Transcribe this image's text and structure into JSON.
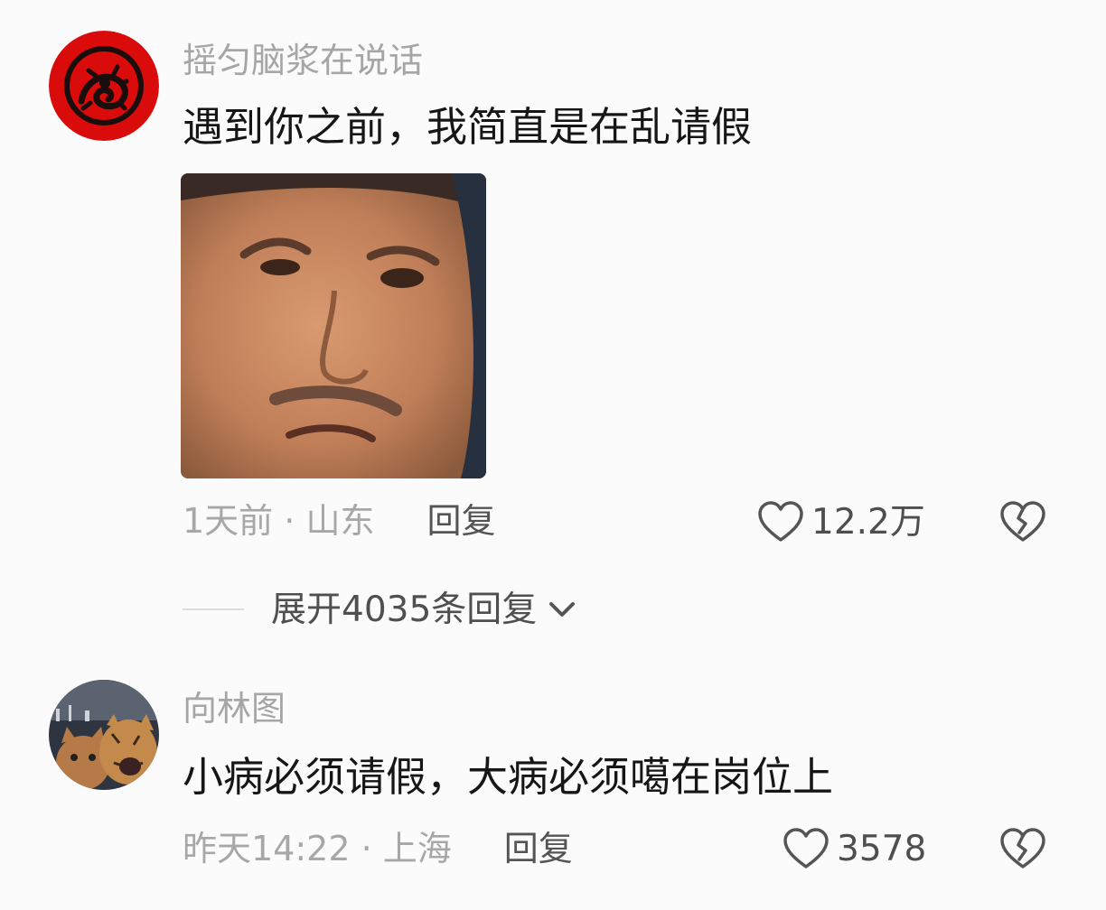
{
  "comments": [
    {
      "username": "摇匀脑浆在说话",
      "text": "遇到你之前，我简直是在乱请假",
      "time": "1天前",
      "location": "山东",
      "reply_label": "回复",
      "likes": "12.2万",
      "expand_label": "展开4035条回复",
      "avatar_icon": "red-dragon-emblem-avatar",
      "image_icon": "meme-face-photo",
      "accent_color": "#d90b0b"
    },
    {
      "username": "向林图",
      "text": "小病必须请假，大病必须噶在岗位上",
      "time": "昨天14:22",
      "location": "上海",
      "reply_label": "回复",
      "likes": "3578",
      "avatar_icon": "cats-photo-avatar"
    }
  ],
  "separator": " · ",
  "icons": [
    "heart-outline-icon",
    "broken-heart-icon",
    "chevron-down-icon"
  ]
}
